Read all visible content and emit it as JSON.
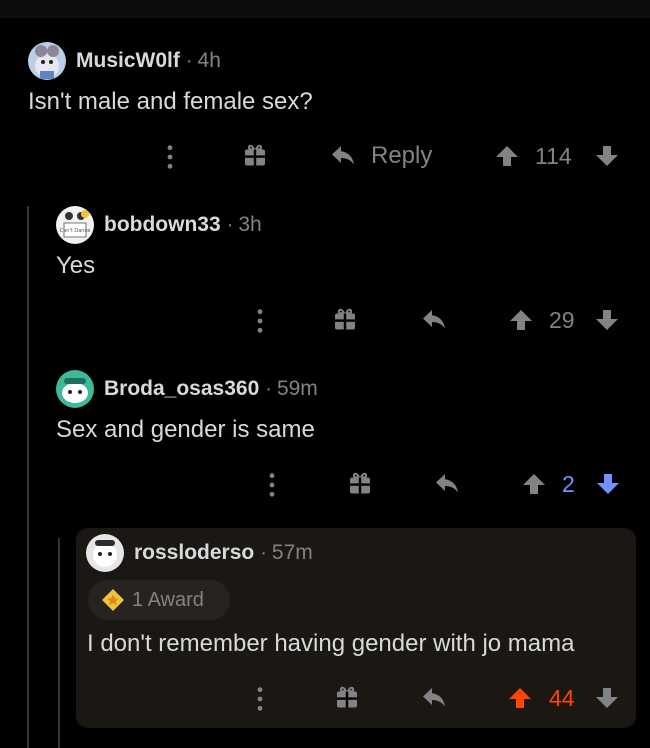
{
  "comments": [
    {
      "username": "MusicW0lf",
      "time": "4h",
      "body": "Isn't male and female sex?",
      "reply_label": "Reply",
      "score": "114"
    },
    {
      "username": "bobdown33",
      "time": "3h",
      "body": "Yes",
      "score": "29",
      "avatar_text": "Can't Dance"
    },
    {
      "username": "Broda_osas360",
      "time": "59m",
      "body": "Sex and gender is same",
      "score": "2",
      "vote_state": "downvoted"
    },
    {
      "username": "rossloderso",
      "time": "57m",
      "award_label": "1 Award",
      "body": "I don't remember having gender with jo mama",
      "score": "44",
      "vote_state": "upvoted"
    }
  ],
  "separator": "·",
  "colors": {
    "background": "#000000",
    "text": "#d7dadc",
    "muted": "#818384",
    "upvote": "#ff4500",
    "downvote": "#7193ff",
    "highlight": "#1b1712"
  },
  "icons": [
    "more-icon",
    "gift-icon",
    "reply-icon",
    "upvote-arrow-icon",
    "downvote-arrow-icon",
    "award-icon"
  ]
}
